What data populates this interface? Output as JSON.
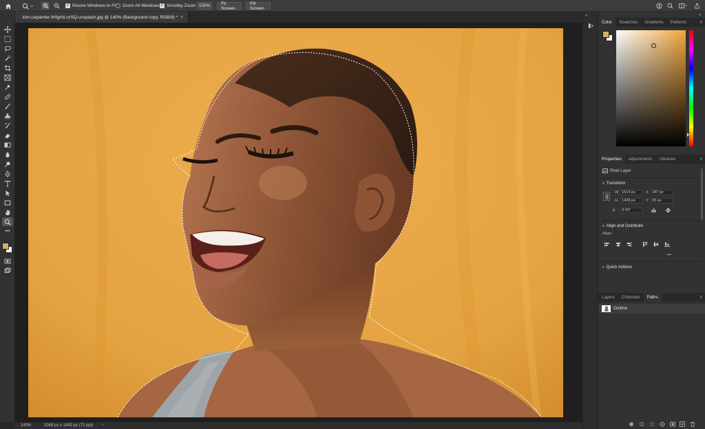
{
  "options_bar": {
    "resize_windows_label": "Resize Windows to Fit",
    "zoom_all_windows_label": "Zoom All Windows",
    "scrubby_zoom_label": "Scrubby Zoom",
    "zoom_percent_button": "100%",
    "fit_screen_button": "Fit Screen",
    "fill_screen_button": "Fill Screen"
  },
  "document": {
    "tab_title": "kim-carpenter-IHIgnhi.vzSQ-unsplash.jpg @ 140% (Background copy, RGB/8) *",
    "close_glyph": "×"
  },
  "status_bar": {
    "zoom": "140%",
    "doc_info": "2048 px x 1492 px (72 ppi)",
    "arrow": "›"
  },
  "color_panel": {
    "tabs": [
      "Color",
      "Swatches",
      "Gradients",
      "Patterns"
    ],
    "active_tab": "Color",
    "foreground_color": "#d9ad6b",
    "background_color": "#ffffff",
    "field_hue": "#f0a53a"
  },
  "properties_panel": {
    "tabs": [
      "Properties",
      "Adjustments",
      "Libraries"
    ],
    "layer_type": "Pixel Layer",
    "transform": {
      "heading": "Transform",
      "w_label": "W",
      "w_value": "1614 px",
      "h_label": "H",
      "h_value": "1428 px",
      "x_label": "X",
      "x_value": "347 px",
      "y_label": "Y",
      "y_value": "65 px",
      "angle_value": "0.00°"
    },
    "align": {
      "heading": "Align and Distribute",
      "label": "Align:",
      "more": "•••"
    },
    "quick_actions": "Quick Actions"
  },
  "layers_panel": {
    "tabs": [
      "Layers",
      "Channels",
      "Paths"
    ],
    "active_tab": "Paths",
    "path_name": "Outline"
  },
  "colors": {
    "backdrop": "#e4a241",
    "skin": "#8d5634",
    "hair": "#3a2418",
    "strap": "#9ea4a8"
  }
}
